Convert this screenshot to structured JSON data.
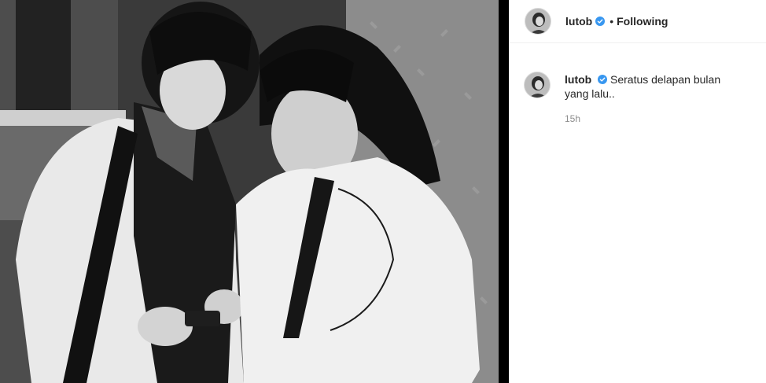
{
  "post": {
    "image_alt": "Black and white photo of two women in white shirts looking at a phone",
    "author": {
      "username": "lutob",
      "verified_icon": "verified-badge-icon",
      "follow_separator": "•",
      "follow_status": "Following"
    },
    "comment": {
      "username": "lutob",
      "caption": "Seratus delapan bulan yang lalu..",
      "timestamp": "15h"
    }
  },
  "colors": {
    "verified": "#3897f0",
    "text": "#262626",
    "muted": "#8e8e8e",
    "border": "#efefef"
  }
}
